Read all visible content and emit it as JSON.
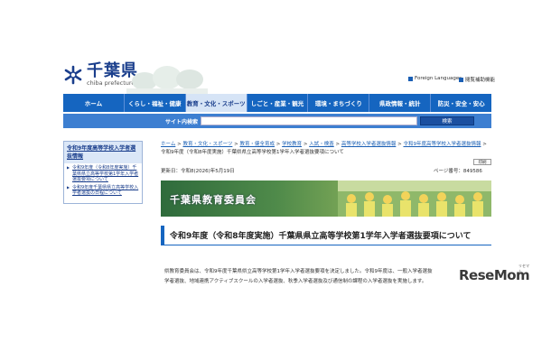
{
  "header": {
    "logo_title": "千葉県",
    "logo_sub": "chiba prefecture",
    "util_links": [
      "Foreign Languages",
      "閲覧補助機能"
    ]
  },
  "nav": {
    "items": [
      "ホーム",
      "くらし・福祉・健康",
      "教育・文化・スポーツ",
      "しごと・産業・観光",
      "環境・まちづくり",
      "県政情報・統計",
      "防災・安全・安心"
    ],
    "active_index": 2
  },
  "search": {
    "label": "サイト内検索",
    "button": "検索",
    "value": ""
  },
  "sidebar": {
    "heading": "令和9年度高等学校入学者選抜情報",
    "items": [
      "令和9年度（令和8年度実施）千葉県県立高等学校第1学年入学者選抜要項について",
      "令和9年度千葉県県立高等学校入学者選抜の日程について"
    ]
  },
  "breadcrumb": {
    "links": [
      "ホーム",
      "教育・文化・スポーツ",
      "教育・健全育成",
      "学校教育",
      "入試・検査",
      "高等学校入学者選抜情報",
      "令和9年度高等学校入学者選抜情報"
    ],
    "sep": " > ",
    "current": "令和9年度（令和8年度実施）千葉県県立高等学校第1学年入学者選抜要項について"
  },
  "meta": {
    "updated": "更新日：令和8(2026)年5月19日",
    "page_id": "ページ番号：849586",
    "print": "印刷"
  },
  "banner": {
    "title": "千葉県教育委員会"
  },
  "page_title": "令和9年度（令和8年度実施）千葉県県立高等学校第1学年入学者選抜要項について",
  "body": {
    "line1": "県教育委員会は、令和9年度千葉県県立高等学校第1学年入学者選抜要項を決定しました。令和9年度は、一般入学者選抜",
    "line2": "学者選抜、地域連携アクティブスクールの入学者選抜、秋季入学者選抜及び通信制の課程の入学者選抜を実施します。"
  },
  "watermark": {
    "text": "ReseMom",
    "small": "リセマム"
  },
  "colors": {
    "nav": "#1565c0",
    "accent": "#1a3e8c",
    "search_bar": "#3d7fd1"
  }
}
